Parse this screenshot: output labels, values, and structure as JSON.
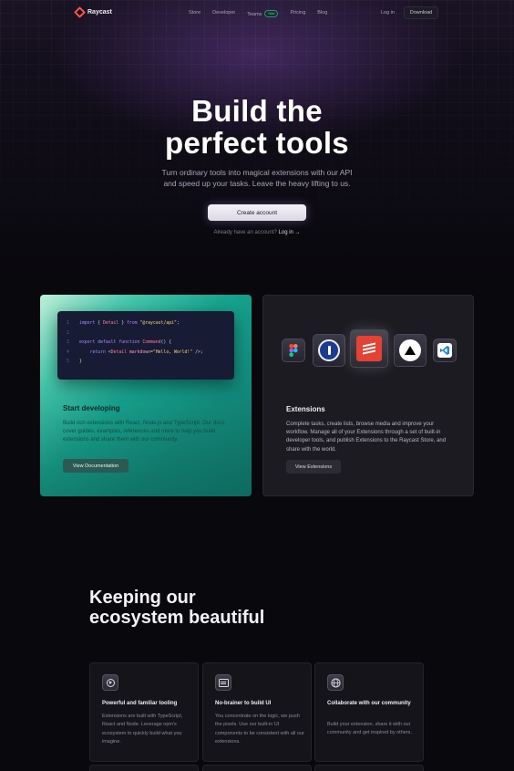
{
  "nav": {
    "brand": "Raycast",
    "links": [
      "Store",
      "Developer",
      "Teams",
      "Pricing",
      "Blog"
    ],
    "teams_badge": "New",
    "login": "Log in",
    "download": "Download"
  },
  "hero": {
    "title_line1": "Build the",
    "title_line2": "perfect tools",
    "subtitle_line1": "Turn ordinary tools into magical extensions with our API",
    "subtitle_line2": "and speed up your tasks. Leave the heavy lifting to us.",
    "cta": "Create account",
    "already_text": "Already have an account?",
    "already_link": "Log in →"
  },
  "dev_card": {
    "code": [
      {
        "n": "1",
        "parts": [
          [
            "kw",
            "import"
          ],
          [
            "t",
            " { "
          ],
          [
            "fn",
            "Detail"
          ],
          [
            "t",
            " } "
          ],
          [
            "kw",
            "from"
          ],
          [
            "t",
            " "
          ],
          [
            "st",
            "\"@raycast/api\""
          ],
          [
            "t",
            ";"
          ]
        ]
      },
      {
        "n": "2",
        "parts": []
      },
      {
        "n": "3",
        "parts": [
          [
            "kw",
            "export default function"
          ],
          [
            "t",
            " "
          ],
          [
            "fn",
            "Command"
          ],
          [
            "t",
            "() {"
          ]
        ]
      },
      {
        "n": "4",
        "parts": [
          [
            "t",
            "    "
          ],
          [
            "kw",
            "return"
          ],
          [
            "t",
            " <"
          ],
          [
            "fn",
            "Detail"
          ],
          [
            "t",
            " "
          ],
          [
            "at",
            "markdown"
          ],
          [
            "t",
            "="
          ],
          [
            "st",
            "\"Hello, World!\""
          ],
          [
            "t",
            " />;"
          ]
        ]
      },
      {
        "n": "5",
        "parts": [
          [
            "t",
            "}"
          ]
        ]
      }
    ],
    "title": "Start developing",
    "description": "Build rich extensions with React, Node.js and TypeScript. Our docs cover guides, examples, references and more to help you build extensions and share them with our community.",
    "button": "View Documentation"
  },
  "ext_card": {
    "apps": [
      "figma-icon",
      "1password-icon",
      "todoist-icon",
      "vercel-icon",
      "vscode-icon"
    ],
    "title": "Extensions",
    "description": "Complete tasks, create lists, browse media and improve your workflow. Manage all of your Extensions through a set of built-in developer tools, and publish Extensions to the Raycast Store, and share with the world.",
    "button": "View Extensions"
  },
  "ecosystem": {
    "title_line1": "Keeping our",
    "title_line2": "ecosystem beautiful",
    "features": [
      {
        "icon": "tooling-icon",
        "title": "Powerful and familiar tooling",
        "description": "Extensions are built with TypeScript, React and Node. Leverage npm's ecosystem to quickly build what you imagine."
      },
      {
        "icon": "ui-icon",
        "title": "No-brainer to build UI",
        "description": "You concentrate on the logic, we push the pixels. Use our built-in UI components to be consistent with all our extensions."
      },
      {
        "icon": "globe-icon",
        "title": "Collaborate with our community",
        "description": "Build your extension, share it with our community and get inspired by others."
      }
    ]
  },
  "colors": {
    "background": "#09080d",
    "accent_teal": "#17a48f",
    "brand_red": "#ff4f4f"
  }
}
